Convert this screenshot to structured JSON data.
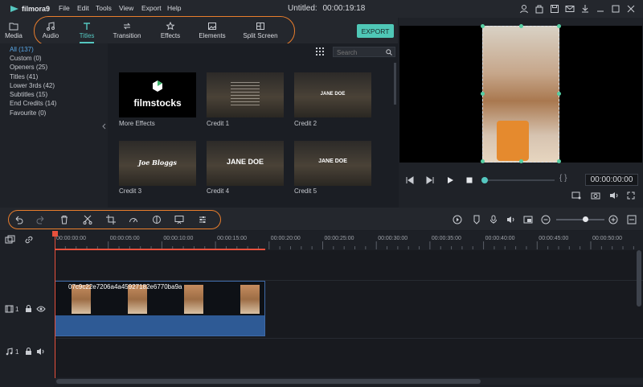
{
  "app": {
    "logo_text": "filmora9",
    "menu": [
      "File",
      "Edit",
      "Tools",
      "View",
      "Export",
      "Help"
    ],
    "title": "Untitled:",
    "title_time": "00:00:19:18"
  },
  "tabs": [
    {
      "label": "Media",
      "icon": "folder-icon"
    },
    {
      "label": "Audio",
      "icon": "music-note-icon"
    },
    {
      "label": "Titles",
      "icon": "titles-icon",
      "active": true
    },
    {
      "label": "Transition",
      "icon": "transition-icon"
    },
    {
      "label": "Effects",
      "icon": "effects-icon"
    },
    {
      "label": "Elements",
      "icon": "image-icon"
    },
    {
      "label": "Split Screen",
      "icon": "split-screen-icon"
    }
  ],
  "export_label": "EXPORT",
  "categories": [
    {
      "label": "All (137)",
      "active": true
    },
    {
      "label": "Custom (0)"
    },
    {
      "label": "Openers (25)"
    },
    {
      "label": "Titles (41)"
    },
    {
      "label": "Lower 3rds (42)"
    },
    {
      "label": "Subtitles (15)"
    },
    {
      "label": "End Credits (14)"
    },
    {
      "label": "Favourite (0)"
    }
  ],
  "search": {
    "placeholder": "Search"
  },
  "grid_items": [
    {
      "label": "More Effects",
      "overlay": "filmstocks"
    },
    {
      "label": "Credit 1",
      "overlay": ""
    },
    {
      "label": "Credit 2",
      "overlay": "JANE DOE"
    },
    {
      "label": "Credit 3",
      "overlay": "Joe Bloggs"
    },
    {
      "label": "Credit 4",
      "overlay": "JANE DOE"
    },
    {
      "label": "Credit 5",
      "overlay": "JANE DOE"
    }
  ],
  "preview": {
    "timecode": "00:00:00:00",
    "bracket_text": "{ }",
    "progress": 0.0
  },
  "timeline": {
    "ruler_ticks": [
      "00:00:00:00",
      "00:00:05:00",
      "00:00:10:00",
      "00:00:15:00",
      "00:00:20:00",
      "00:00:25:00",
      "00:00:30:00",
      "00:00:35:00",
      "00:00:40:00",
      "00:00:45:00",
      "00:00:50:00"
    ],
    "clip_name": "07c9c22e7206a4a45927182e6770ba9a",
    "video_track_label": "1",
    "audio_track_label": "1",
    "zoom_level": 0.75
  },
  "colors": {
    "accent": "#55c7c0",
    "export": "#4fc7b6",
    "highlight_oval": "#e87d2c",
    "playhead": "#e8513d",
    "active_category": "#58a8e8"
  }
}
